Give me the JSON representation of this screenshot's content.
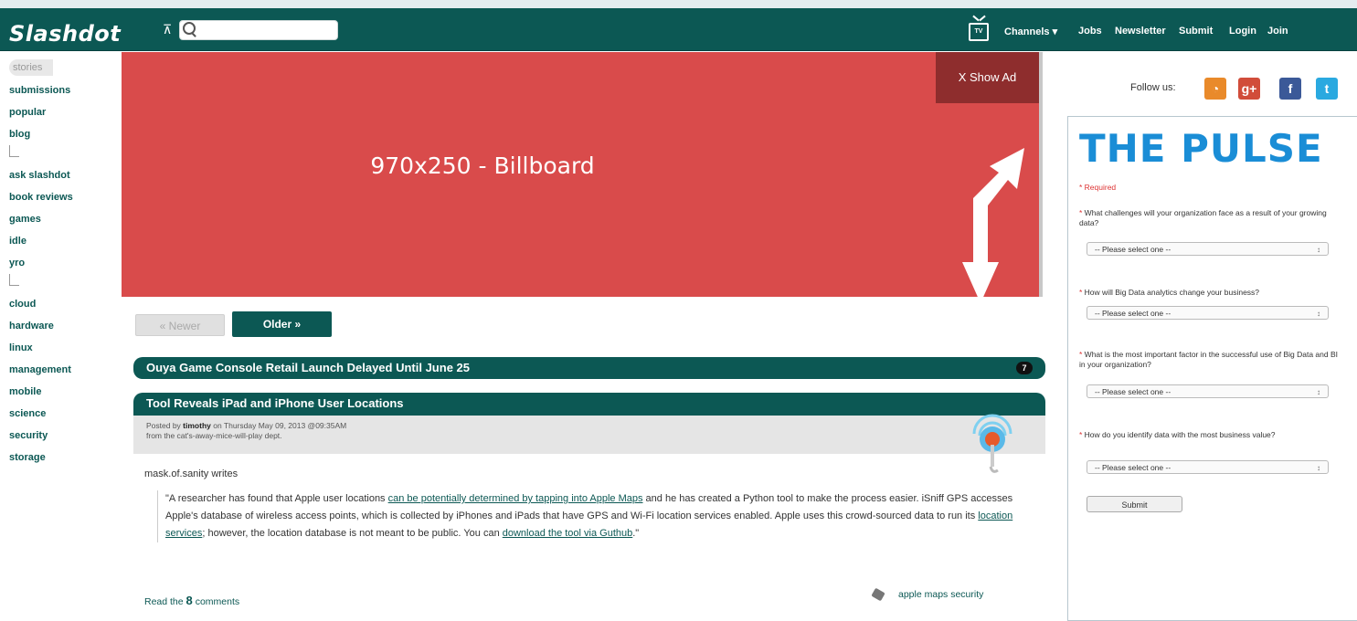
{
  "header": {
    "logo": "Slashdot",
    "search_placeholder": "",
    "tv_label": "TV",
    "nav": [
      "Channels ▾",
      "Jobs",
      "Newsletter",
      "Submit",
      "Login",
      "Join"
    ]
  },
  "sidebar": {
    "items": [
      "stories",
      "submissions",
      "popular",
      "blog",
      "ask slashdot",
      "book reviews",
      "games",
      "idle",
      "yro",
      "cloud",
      "hardware",
      "linux",
      "management",
      "mobile",
      "science",
      "security",
      "storage"
    ]
  },
  "ad": {
    "label": "970x250 - Billboard",
    "show_ad": "X   Show Ad"
  },
  "pager": {
    "newer": "« Newer",
    "older": "Older »"
  },
  "stories": [
    {
      "title": "Ouya Game Console Retail Launch Delayed Until June 25",
      "comments": "7"
    },
    {
      "title": "Tool Reveals iPad and iPhone User Locations"
    }
  ],
  "story_meta": {
    "posted_prefix": "Posted by ",
    "author": "timothy",
    "posted_suffix": " on Thursday May 09, 2013 @09:35AM",
    "dept": "from the cat's-away-mice-will-play dept."
  },
  "story_body": {
    "submitter": "mask.of.sanity writes",
    "q1": "\"A researcher has found that Apple user locations ",
    "link1": "can be potentially determined by tapping into Apple Maps",
    "q2": " and he has created a Python tool to make the process easier. iSniff GPS accesses Apple's database of wireless access points, which is collected by iPhones and iPads that have GPS and Wi-Fi location services enabled. Apple uses this crowd-sourced data to run its ",
    "link2": "location services",
    "q3": "; however, the location database is not meant to be public. You can ",
    "link3": "download the tool via Guthub",
    "q4": ".\""
  },
  "story_footer": {
    "read_prefix": "Read the ",
    "count": "8",
    "read_suffix": " comments",
    "tags": "apple   maps   security"
  },
  "right": {
    "follow": "Follow us:",
    "pulse_title": "THE PULSE",
    "required": "* Required",
    "questions": [
      "What challenges will your organization face as a result of your growing data?",
      "How will Big Data analytics change your business?",
      "What is the most important factor in the successful use of Big Data and BI in your organization?",
      "How do you identify data with the most business value?"
    ],
    "select_placeholder": "-- Please select one --",
    "submit": "Submit"
  },
  "colors": {
    "brand": "#0c5854",
    "ad": "#d94b4b",
    "pulse": "#1a8dd6"
  }
}
